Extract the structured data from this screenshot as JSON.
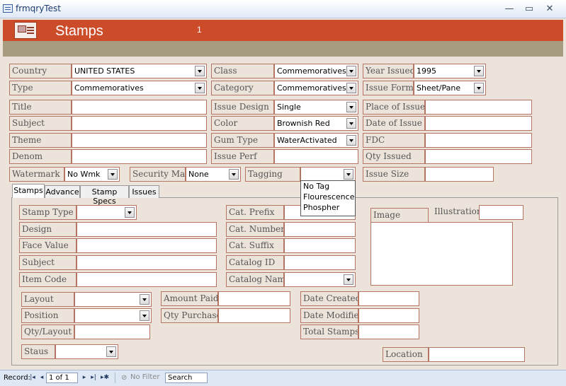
{
  "window": {
    "title": "frmqryTest",
    "minimize_glyph": "—",
    "restore_glyph": "▭",
    "close_glyph": "✕"
  },
  "header": {
    "title": "Stamps",
    "record_number": "1"
  },
  "fields": {
    "country": {
      "label": "Country",
      "value": "UNITED STATES"
    },
    "class": {
      "label": "Class",
      "value": "Commemoratives"
    },
    "year_issued": {
      "label": "Year Issued",
      "value": "1995"
    },
    "type": {
      "label": "Type",
      "value": "Commemoratives"
    },
    "category": {
      "label": "Category",
      "value": "Commemoratives"
    },
    "issue_format": {
      "label": "Issue Format",
      "value": "Sheet/Pane"
    },
    "title": {
      "label": "Title",
      "value": ""
    },
    "issue_design": {
      "label": "Issue Design",
      "value": "Single"
    },
    "place_of_issue": {
      "label": "Place of Issue",
      "value": ""
    },
    "subject": {
      "label": "Subject",
      "value": ""
    },
    "color": {
      "label": "Color",
      "value": "Brownish Red"
    },
    "date_of_issue": {
      "label": "Date of Issue",
      "value": ""
    },
    "theme": {
      "label": "Theme",
      "value": ""
    },
    "gum_type": {
      "label": "Gum Type",
      "value": "WaterActivated"
    },
    "fdc": {
      "label": "FDC",
      "value": ""
    },
    "denom": {
      "label": "Denom",
      "value": ""
    },
    "issue_perf": {
      "label": "Issue Perf",
      "value": ""
    },
    "qty_issued": {
      "label": "Qty Issued",
      "value": ""
    },
    "watermark": {
      "label": "Watermark",
      "value": "No Wmk"
    },
    "security_mark": {
      "label": "Security Mark",
      "value": "None"
    },
    "tagging": {
      "label": "Tagging",
      "value": ""
    },
    "issue_size": {
      "label": "Issue Size",
      "value": ""
    }
  },
  "tagging_options": [
    "No Tag",
    "Flourescence",
    "Phospher"
  ],
  "tabs": [
    "Stamps",
    "Advance",
    "Stamp Specs",
    "Issues"
  ],
  "stamps_tab": {
    "stamp_type": {
      "label": "Stamp Type",
      "value": ""
    },
    "design": {
      "label": "Design",
      "value": ""
    },
    "face_value": {
      "label": "Face Value",
      "value": ""
    },
    "subject": {
      "label": "Subject",
      "value": ""
    },
    "item_code": {
      "label": "Item Code",
      "value": ""
    },
    "cat_prefix": {
      "label": "Cat. Prefix",
      "value": ""
    },
    "cat_number": {
      "label": "Cat. Number",
      "value": ""
    },
    "cat_suffix": {
      "label": "Cat. Suffix",
      "value": ""
    },
    "catalog_id": {
      "label": "Catalog ID",
      "value": ""
    },
    "catalog_name": {
      "label": "Catalog Name",
      "value": ""
    },
    "image": {
      "label": "Image"
    },
    "illustration": {
      "label": "Illustration:",
      "value": ""
    },
    "layout": {
      "label": "Layout",
      "value": ""
    },
    "position": {
      "label": "Position",
      "value": ""
    },
    "qty_layout": {
      "label": "Qty/Layout",
      "value": ""
    },
    "staus": {
      "label": "Staus",
      "value": ""
    },
    "amount_paid": {
      "label": "Amount Paid",
      "value": ""
    },
    "qty_purchased": {
      "label": "Qty Purchased",
      "value": ""
    },
    "date_created": {
      "label": "Date Created",
      "value": ""
    },
    "date_modified": {
      "label": "Date Modified",
      "value": ""
    },
    "total_stamps": {
      "label": "Total Stamps",
      "value": ""
    },
    "location": {
      "label": "Location",
      "value": ""
    }
  },
  "navbar": {
    "record_label": "Record:",
    "first_glyph": "|◂",
    "prev_glyph": "◂",
    "record_position": "1 of 1",
    "next_glyph": "▸",
    "last_glyph": "▸|",
    "new_glyph": "▸✱",
    "filter_label": "No Filter",
    "filter_glyph": "⊘",
    "search_placeholder": "Search"
  },
  "colors": {
    "header_bar": "#cc4c2a",
    "subheader_bar": "#a89c80",
    "form_background": "#ece4da",
    "field_border": "#b67464"
  }
}
